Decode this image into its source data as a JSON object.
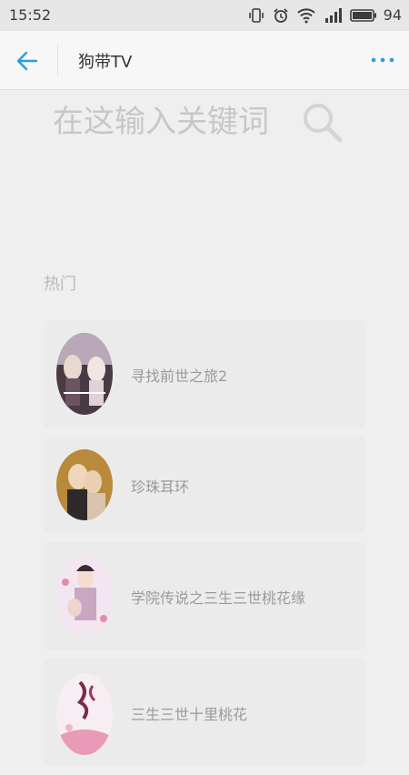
{
  "status_bar": {
    "time": "15:52",
    "battery": "94"
  },
  "app_bar": {
    "title": "狗带TV"
  },
  "search": {
    "placeholder": "在这输入关键词"
  },
  "section": {
    "title": "热门"
  },
  "items": [
    {
      "title": "寻找前世之旅2"
    },
    {
      "title": "珍珠耳环"
    },
    {
      "title": "学院传说之三生三世桃花缘"
    },
    {
      "title": "三生三世十里桃花"
    }
  ],
  "colors": {
    "accent": "#2a9be3",
    "background": "#efefef",
    "card": "#ebebeb"
  }
}
